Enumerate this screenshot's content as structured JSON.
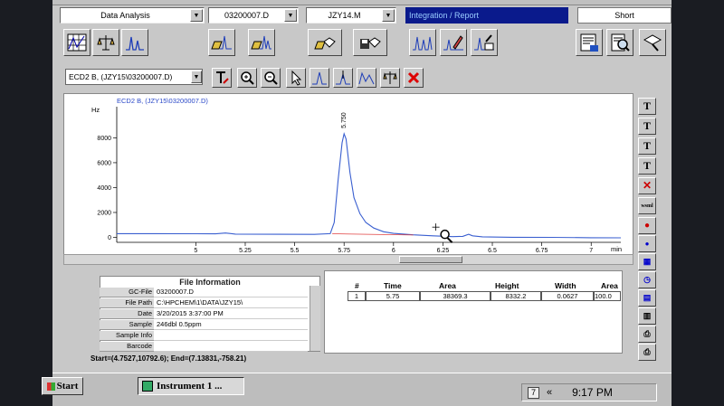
{
  "toolbar": {
    "view_selector": "Data Analysis",
    "datafile_selector": "03200007.D",
    "method_selector": "JZY14.M",
    "integration_header": "Integration / Report",
    "report_style": "Short"
  },
  "signal_selector": "ECD2 B, (JZY15\\03200007.D)",
  "chart_data": {
    "type": "line",
    "title": "ECD2 B, (JZY15\\03200007.D)",
    "ylabel": "Hz",
    "xlabel": "min",
    "xlim": [
      4.6,
      7.15
    ],
    "ylim": [
      -400,
      10500
    ],
    "yticks": [
      "0",
      "2000",
      "4000",
      "6000",
      "8000"
    ],
    "ytick_values": [
      0,
      2000,
      4000,
      6000,
      8000
    ],
    "xticks": [
      "5",
      "5.25",
      "5.5",
      "5.75",
      "6",
      "6.25",
      "6.5",
      "6.75",
      "7"
    ],
    "xtick_values": [
      5,
      5.25,
      5.5,
      5.75,
      6,
      6.25,
      6.5,
      6.75,
      7
    ],
    "peak_label": "5.750",
    "peak_time": 5.75,
    "series": [
      {
        "color": "#3a5fd0",
        "x": [
          4.6,
          4.8,
          5.0,
          5.1,
          5.15,
          5.2,
          5.4,
          5.6,
          5.68,
          5.7,
          5.72,
          5.74,
          5.75,
          5.76,
          5.78,
          5.8,
          5.83,
          5.86,
          5.9,
          5.95,
          6.0,
          6.1,
          6.2,
          6.3,
          6.35,
          6.38,
          6.4,
          6.45,
          6.6,
          6.8,
          7.0,
          7.15
        ],
        "y": [
          300,
          300,
          290,
          280,
          350,
          260,
          250,
          240,
          300,
          1200,
          4600,
          7600,
          8330,
          7900,
          5200,
          3200,
          1900,
          1200,
          750,
          450,
          320,
          200,
          120,
          60,
          80,
          250,
          120,
          40,
          10,
          0,
          -30,
          -40
        ]
      }
    ],
    "baseline_color": "#e04040"
  },
  "file_info": {
    "title": "File Information",
    "rows": [
      {
        "label": "GC-File",
        "value": "03200007.D"
      },
      {
        "label": "File Path",
        "value": "C:\\HPCHEM\\1\\DATA\\JZY15\\"
      },
      {
        "label": "Date",
        "value": "3/20/2015 3:37:00 PM"
      },
      {
        "label": "Sample",
        "value": "246dbl 0.5ppm"
      },
      {
        "label": "Sample Info",
        "value": ""
      },
      {
        "label": "Barcode",
        "value": ""
      }
    ]
  },
  "results_table": {
    "headers": [
      "#",
      "Time",
      "Area",
      "Height",
      "Width",
      "Area"
    ],
    "rows": [
      [
        "1",
        "5.75",
        "38369.3",
        "8332.2",
        "0.0627",
        "100.0"
      ]
    ]
  },
  "status_line": "Start=(4.7527,10792.6); End=(7.13831,-758.21)",
  "taskbar": {
    "start_label": "Start",
    "task_label": "Instrument 1 ...",
    "tray_badge": "7",
    "tray_chevron": "«",
    "clock": "9:17 PM"
  }
}
